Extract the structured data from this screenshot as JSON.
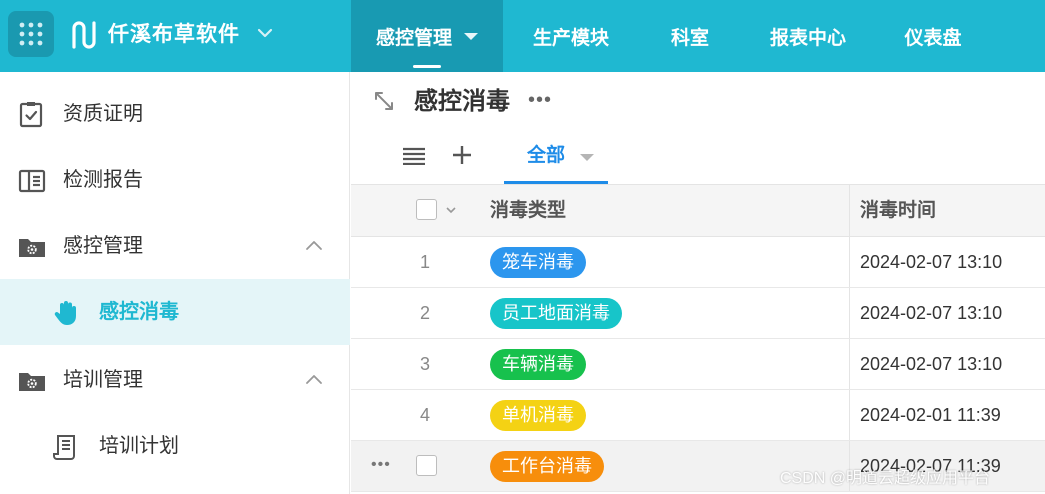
{
  "header": {
    "brand": "仟溪布草软件",
    "nav": [
      {
        "label": "感控管理",
        "active": true
      },
      {
        "label": "生产模块"
      },
      {
        "label": "科室"
      },
      {
        "label": "报表中心"
      },
      {
        "label": "仪表盘"
      }
    ]
  },
  "sidebar": {
    "items": [
      {
        "label": "资质证明",
        "icon": "clipboard-check-icon"
      },
      {
        "label": "检测报告",
        "icon": "report-panel-icon"
      },
      {
        "label": "感控管理",
        "icon": "folder-gear-icon",
        "expanded": true
      },
      {
        "label": "感控消毒",
        "icon": "hand-icon",
        "active": true
      },
      {
        "label": "培训管理",
        "icon": "folder-gear-icon",
        "expanded": true
      },
      {
        "label": "培训计划",
        "icon": "scroll-document-icon"
      }
    ]
  },
  "main": {
    "title": "感控消毒",
    "title_more": "•••",
    "view_tab": "全部",
    "table": {
      "columns": [
        "消毒类型",
        "消毒时间"
      ],
      "rows": [
        {
          "num": "1",
          "type": "笼车消毒",
          "color": "#2c96ee",
          "time": "2024-02-07 13:10"
        },
        {
          "num": "2",
          "type": "员工地面消毒",
          "color": "#17c5c9",
          "time": "2024-02-07 13:10"
        },
        {
          "num": "3",
          "type": "车辆消毒",
          "color": "#17c14d",
          "time": "2024-02-07 13:10"
        },
        {
          "num": "4",
          "type": "单机消毒",
          "color": "#f4d214",
          "time": "2024-02-01 11:39"
        },
        {
          "num": "",
          "type": "工作台消毒",
          "color": "#f78e0c",
          "time": "2024-02-07 11:39",
          "row_more": "•••"
        }
      ]
    }
  },
  "watermark": "CSDN @明道云超级应用平台",
  "colors": {
    "header_bg": "#1fb8d1",
    "nav_active_bg": "#189ab2",
    "accent": "#1fb8d1",
    "tab_blue": "#1e8ce8"
  }
}
